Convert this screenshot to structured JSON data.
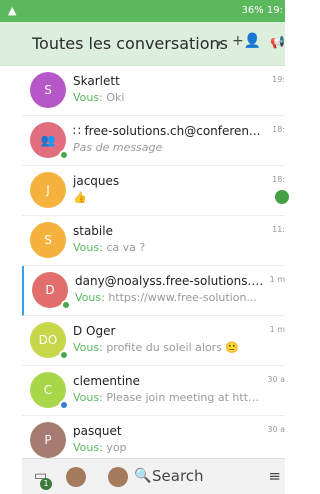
{
  "statusbar": {
    "left_icon": "▲",
    "right_text": "36% 19:"
  },
  "header": {
    "title": "Toutes les conversations",
    "caret": "▾",
    "add_user_icon": "+👤",
    "megaphone_icon": "📢"
  },
  "conversations": [
    {
      "initials": "S",
      "color": "#b657c8",
      "name": "Skarlett",
      "you": "Vous:",
      "message": "Oki",
      "time": "19:",
      "dot": "",
      "badge": false
    },
    {
      "initials": "👥",
      "color": "#e26d7f",
      "name": "∷ free-solutions.ch@conferen...",
      "you": "",
      "message": "Pas de message",
      "time": "18:",
      "dot": "#4aa64a",
      "badge": false
    },
    {
      "initials": "J",
      "color": "#f5b23e",
      "name": "jacques",
      "you": "",
      "message": "👍",
      "time": "18:",
      "dot": "",
      "badge": true
    },
    {
      "initials": "S",
      "color": "#f5b23e",
      "name": "stabile",
      "you": "Vous:",
      "message": "ca va ?",
      "time": "11:",
      "dot": "",
      "badge": false
    },
    {
      "initials": "D",
      "color": "#e26d6d",
      "name": "dany@noalyss.free-solutions.org",
      "you": "Vous:",
      "message": "https://www.free-solution...",
      "time": "1 m",
      "dot": "#4aa64a",
      "badge": false
    },
    {
      "initials": "DO",
      "color": "#c6d84a",
      "name": "D Oger",
      "you": "Vous:",
      "message": "profite du soleil alors 🙂",
      "time": "1 m",
      "dot": "#4aa64a",
      "badge": false
    },
    {
      "initials": "C",
      "color": "#a8d84a",
      "name": "clementine",
      "you": "Vous:",
      "message": "Please join meeting at http...",
      "time": "30 a",
      "dot": "#3a7cd8",
      "badge": false
    },
    {
      "initials": "P",
      "color": "#a57b72",
      "name": "pasquet",
      "you": "Vous:",
      "message": "yop",
      "time": "30 a",
      "dot": "",
      "badge": false
    }
  ],
  "bottombar": {
    "badge_count": "1",
    "search_label": "Search",
    "menu_icon": "≡"
  }
}
